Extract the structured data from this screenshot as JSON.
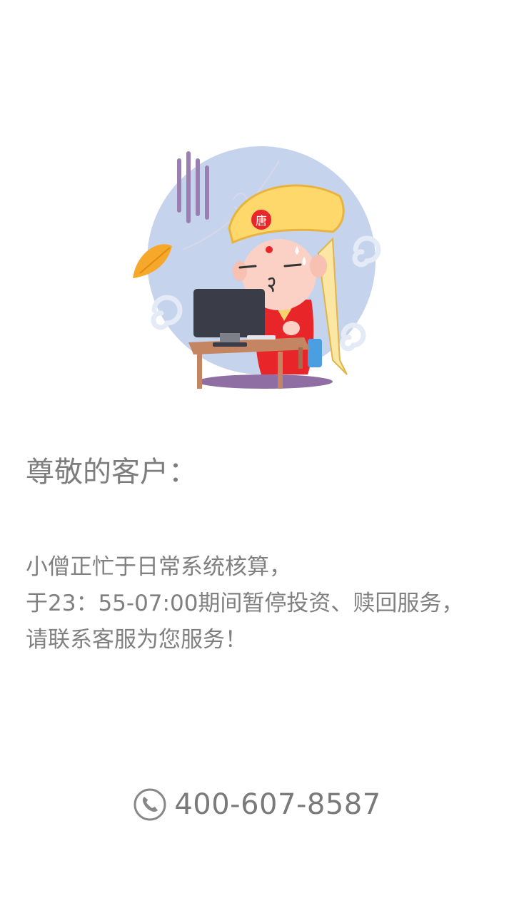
{
  "greeting": "尊敬的客户：",
  "message": {
    "line1": "小僧正忙于日常系统核算，",
    "line2": "于23：55-07:00期间暂停投资、赎回服务，",
    "line3": "请联系客服为您服务！"
  },
  "contact": {
    "phone_number": "400-607-8587",
    "icon": "phone-icon"
  },
  "illustration": {
    "badge_text": "唐"
  },
  "colors": {
    "text": "#7a7a7a",
    "background": "#ffffff",
    "circle": "#c5d3ec",
    "hat": "#ffd86b",
    "robe": "#e8262a"
  }
}
